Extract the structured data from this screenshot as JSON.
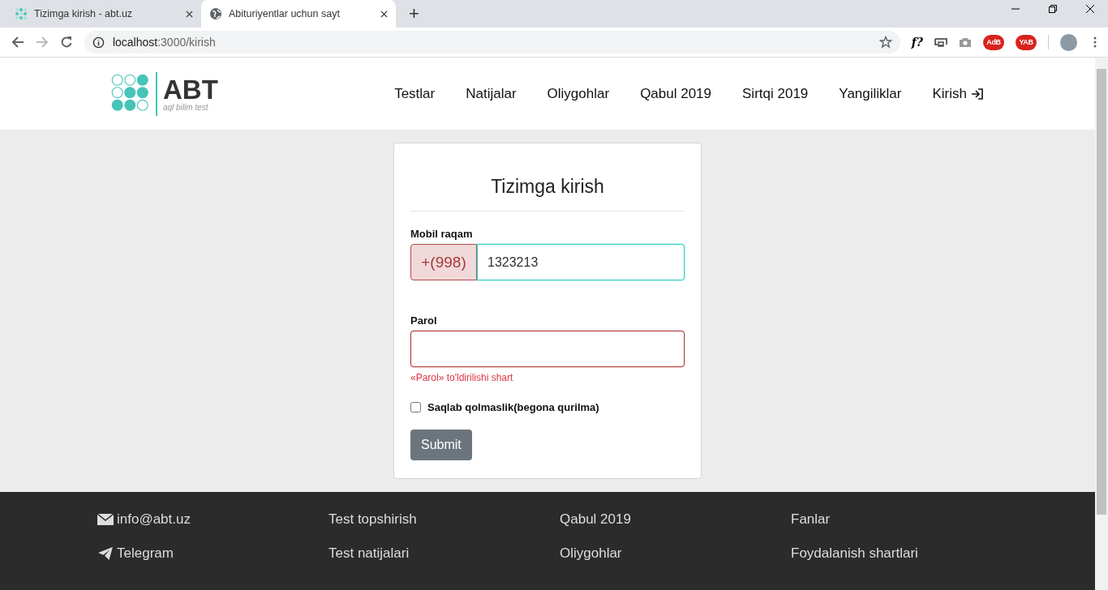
{
  "browser": {
    "tabs": [
      {
        "title": "Tizimga kirish - abt.uz",
        "kind": "site",
        "selected": false
      },
      {
        "title": "Abituriyentlar uchun sayt",
        "kind": "web",
        "selected": true
      }
    ],
    "new_tab": "+",
    "address": {
      "host": "localhost",
      "path": ":3000/kirish"
    },
    "extensions": [
      {
        "kind": "text",
        "label": "f?"
      },
      {
        "kind": "cast"
      },
      {
        "kind": "camera"
      },
      {
        "kind": "badge",
        "label": "AdB"
      },
      {
        "kind": "badge",
        "label": "YAB"
      }
    ]
  },
  "header": {
    "logo": {
      "title": "ABT",
      "subtitle": "aql bilim test",
      "dots": [
        false,
        false,
        true,
        false,
        true,
        true,
        true,
        true,
        false
      ]
    },
    "nav": [
      {
        "label": "Testlar",
        "kind": "link"
      },
      {
        "label": "Natijalar",
        "kind": "link"
      },
      {
        "label": "Oliygohlar",
        "kind": "link"
      },
      {
        "label": "Qabul 2019",
        "kind": "link"
      },
      {
        "label": "Sirtqi 2019",
        "kind": "link"
      },
      {
        "label": "Yangiliklar",
        "kind": "link"
      },
      {
        "label": "Kirish",
        "kind": "login"
      }
    ]
  },
  "form": {
    "title": "Tizimga kirish",
    "phone": {
      "label": "Mobil raqam",
      "prefix": "+(998)",
      "value": "1323213",
      "focused": true
    },
    "password": {
      "label": "Parol",
      "invalid": true,
      "error": "«Parol» to'ldirilishi shart"
    },
    "remember": {
      "label": "Saqlab qolmaslik(begona qurilma)",
      "checked": false
    },
    "submit": "Submit"
  },
  "footer": {
    "columns": [
      [
        {
          "label": "info@abt.uz",
          "kind": "mail"
        },
        {
          "label": "Telegram",
          "kind": "telegram"
        }
      ],
      [
        {
          "label": "Test topshirish",
          "kind": "link"
        },
        {
          "label": "Test natijalari",
          "kind": "link"
        }
      ],
      [
        {
          "label": "Qabul 2019",
          "kind": "link"
        },
        {
          "label": "Oliygohlar",
          "kind": "link"
        }
      ],
      [
        {
          "label": "Fanlar",
          "kind": "link"
        },
        {
          "label": "Foydalanish shartlari",
          "kind": "link"
        }
      ]
    ]
  }
}
